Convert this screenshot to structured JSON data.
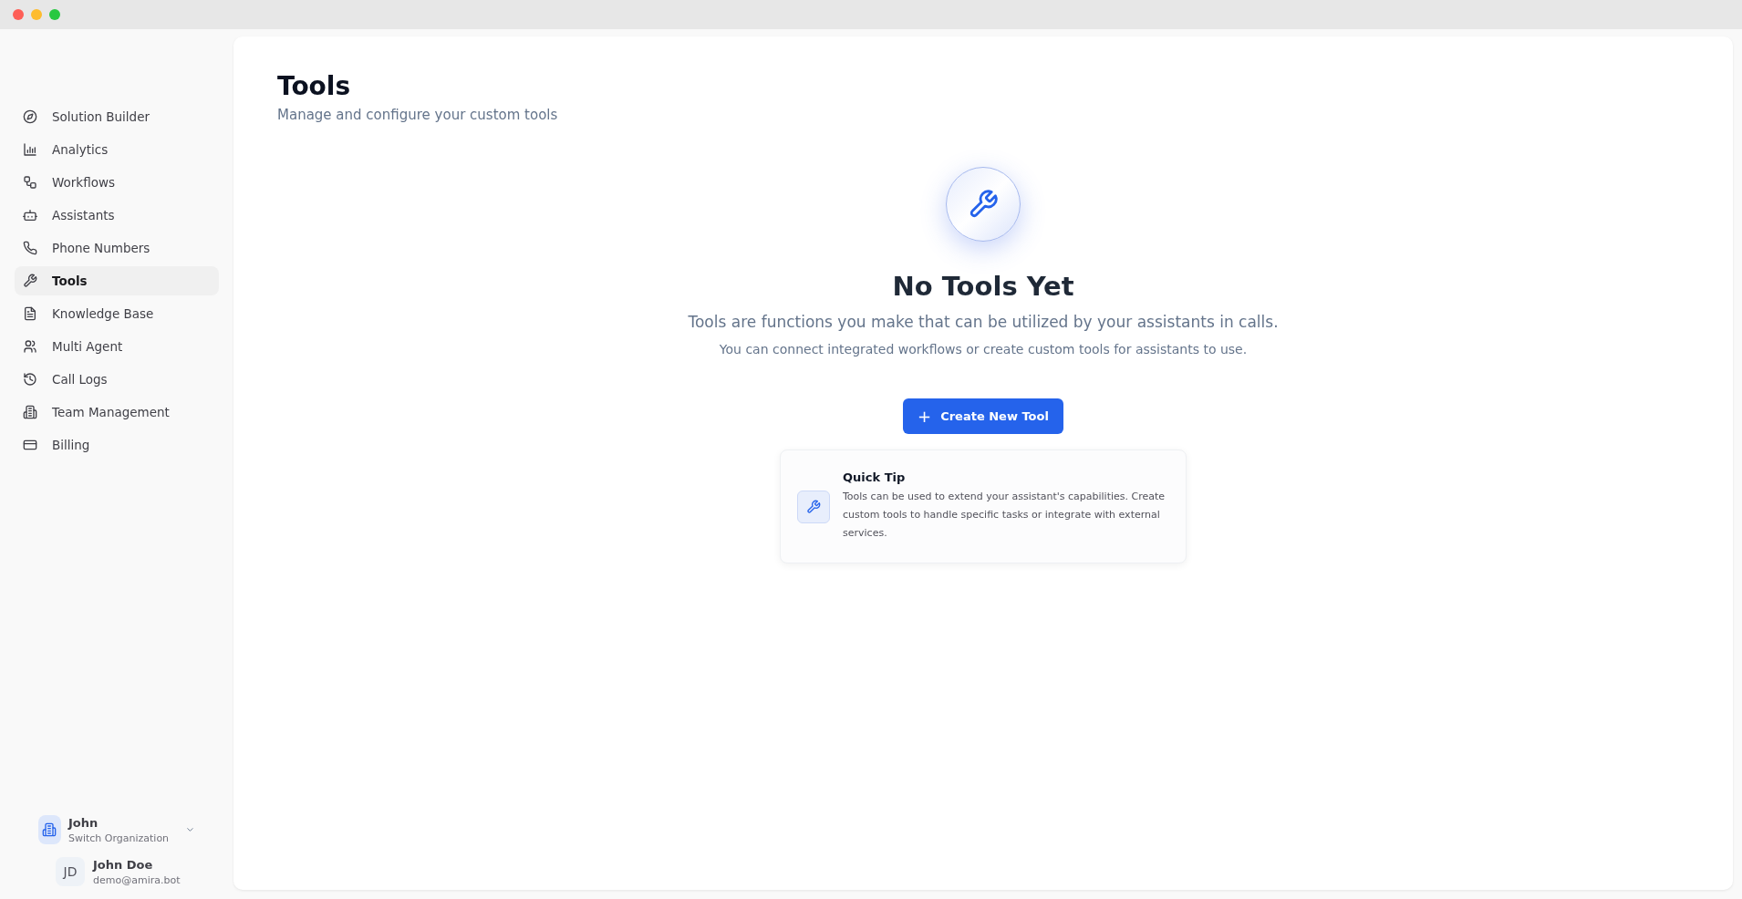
{
  "sidebar": {
    "items": [
      {
        "label": "Solution Builder",
        "kind": "compass",
        "selected": false
      },
      {
        "label": "Analytics",
        "kind": "chart",
        "selected": false
      },
      {
        "label": "Workflows",
        "kind": "flow",
        "selected": false
      },
      {
        "label": "Assistants",
        "kind": "bot",
        "selected": false
      },
      {
        "label": "Phone Numbers",
        "kind": "phone",
        "selected": false
      },
      {
        "label": "Tools",
        "kind": "wrench",
        "selected": true
      },
      {
        "label": "Knowledge Base",
        "kind": "file",
        "selected": false
      },
      {
        "label": "Multi Agent",
        "kind": "users",
        "selected": false
      },
      {
        "label": "Call Logs",
        "kind": "history",
        "selected": false
      },
      {
        "label": "Team Management",
        "kind": "building",
        "selected": false
      },
      {
        "label": "Billing",
        "kind": "card",
        "selected": false
      }
    ],
    "organization": {
      "name": "John",
      "action": "Switch Organization"
    },
    "user": {
      "initials": "JD",
      "name": "John Doe",
      "email": "demo@amira.bot"
    }
  },
  "page": {
    "title": "Tools",
    "subtitle": "Manage and configure your custom tools"
  },
  "empty_state": {
    "heading": "No Tools Yet",
    "lines": [
      "Tools are functions you make that can be utilized by your assistants in calls.",
      "You can connect integrated workflows or create custom tools for assistants to use."
    ],
    "button": {
      "icon": "+",
      "label": "Create New Tool"
    }
  },
  "tip": {
    "title": "Quick Tip",
    "text": "Tools can be used to extend your assistant's capabilities. Create custom tools to handle specific tasks or integrate with external services."
  }
}
